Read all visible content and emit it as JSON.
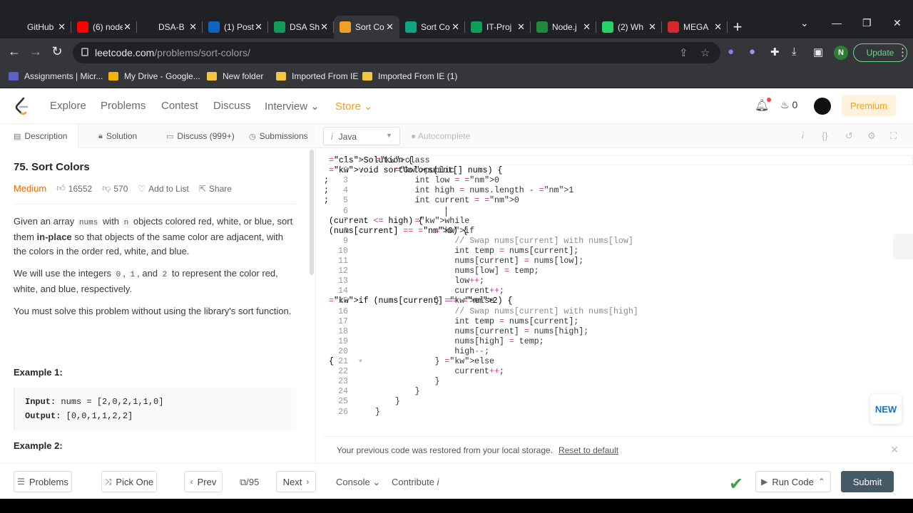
{
  "browser": {
    "tabs": [
      {
        "title": "GitHub",
        "icon": "github-icon",
        "color": "#202124"
      },
      {
        "title": "(6) node",
        "icon": "youtube-icon",
        "color": "#ff0000"
      },
      {
        "title": "DSA-B",
        "icon": "github-icon",
        "color": "#202124"
      },
      {
        "title": "(1) Post",
        "icon": "linkedin-icon",
        "color": "#0a66c2"
      },
      {
        "title": "DSA Sh",
        "icon": "sheets-icon",
        "color": "#0f9d58"
      },
      {
        "title": "Sort Co",
        "icon": "leetcode-icon",
        "color": "#f0a023",
        "active": true
      },
      {
        "title": "Sort Co",
        "icon": "chatgpt-icon",
        "color": "#10a37f"
      },
      {
        "title": "IT-Proj",
        "icon": "sheets-icon",
        "color": "#0f9d58"
      },
      {
        "title": "Node.j",
        "icon": "w-icon",
        "color": "#1f8a3b"
      },
      {
        "title": "(2) Wh",
        "icon": "whatsapp-icon",
        "color": "#25d366"
      },
      {
        "title": "MEGA",
        "icon": "mega-icon",
        "color": "#d9272e"
      }
    ],
    "url_host": "leetcode.com",
    "url_path": "/problems/sort-colors/",
    "profile_initial": "N",
    "update_label": "Update",
    "bookmarks": [
      {
        "label": "Assignments | Micr...",
        "icon": "teams-icon",
        "color": "#5b5fc7"
      },
      {
        "label": "My Drive - Google...",
        "icon": "drive-icon",
        "color": "#f4b400"
      },
      {
        "label": "New folder",
        "icon": "folder-icon",
        "color": "#f5c542"
      },
      {
        "label": "Imported From IE",
        "icon": "folder-icon",
        "color": "#f5c542"
      },
      {
        "label": "Imported From IE (1)",
        "icon": "folder-icon",
        "color": "#f5c542"
      }
    ]
  },
  "nav": {
    "items": [
      "Explore",
      "Problems",
      "Contest",
      "Discuss",
      "Interview",
      "Store"
    ],
    "streak": "0",
    "premium": "Premium"
  },
  "problem": {
    "tabs": [
      "Description",
      "Solution",
      "Discuss (999+)",
      "Submissions"
    ],
    "title": "75. Sort Colors",
    "difficulty": "Medium",
    "likes": "16552",
    "dislikes": "570",
    "add_to_list": "Add to List",
    "share": "Share",
    "p1_a": "Given an array",
    "p1_code1": "nums",
    "p1_b": "with",
    "p1_code2": "n",
    "p1_c": "objects colored red, white, or blue, sort them",
    "p1_bold": "in-place",
    "p1_d": "so that objects of the same color are adjacent, with the colors in the order red, white, and blue.",
    "p2_a": "We will use the integers",
    "p2_c0": "0",
    "p2_c1": "1",
    "p2_and": ", and",
    "p2_c2": "2",
    "p2_b": "to represent the color red, white, and blue, respectively.",
    "p3": "You must solve this problem without using the library's sort function.",
    "example1_title": "Example 1:",
    "example1_input_label": "Input:",
    "example1_input": "nums = [2,0,2,1,1,0]",
    "example1_output_label": "Output:",
    "example1_output": "[0,0,1,1,2,2]",
    "example2_title": "Example 2:"
  },
  "editor": {
    "language": "Java",
    "autocomplete": "Autocomplete",
    "lines": [
      "class Solution {",
      "    public void sortColors(int[] nums) {",
      "        int low = 0;",
      "        int high = nums.length - 1;",
      "        int current = 0;",
      "",
      "        while (current <= high) {",
      "            if (nums[current] == 0) {",
      "                // Swap nums[current] with nums[low]",
      "                int temp = nums[current];",
      "                nums[current] = nums[low];",
      "                nums[low] = temp;",
      "                low++;",
      "                current++;",
      "            } else if (nums[current] == 2) {",
      "                // Swap nums[current] with nums[high]",
      "                int temp = nums[current];",
      "                nums[current] = nums[high];",
      "                nums[high] = temp;",
      "                high--;",
      "            } else {",
      "                current++;",
      "            }",
      "        }",
      "    }",
      "}"
    ],
    "restore_msg": "Your previous code was restored from your local storage.",
    "reset_link": "Reset to default",
    "new_badge": "NEW"
  },
  "bottom": {
    "problems": "Problems",
    "pick_one": "Pick One",
    "prev": "Prev",
    "page": "/95",
    "next": "Next",
    "console": "Console",
    "contribute": "Contribute",
    "run_code": "Run Code",
    "submit": "Submit"
  }
}
